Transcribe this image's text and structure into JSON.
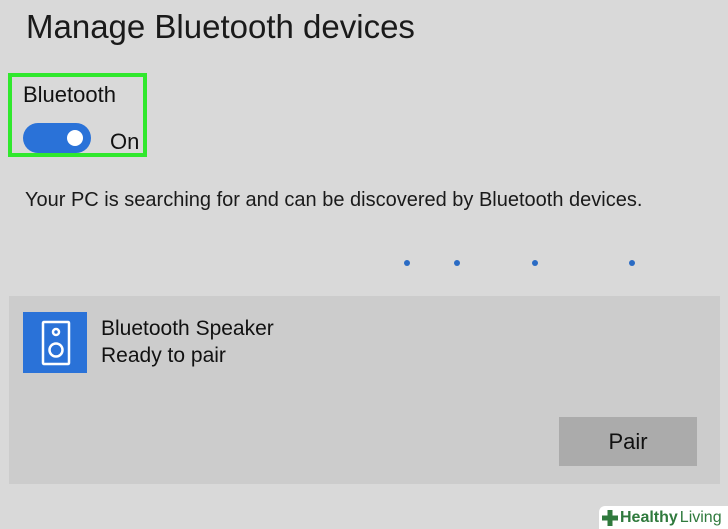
{
  "header": {
    "title": "Manage Bluetooth devices"
  },
  "bluetooth_toggle": {
    "label": "Bluetooth",
    "state_label": "On",
    "is_on": true,
    "highlight_color": "#30e82d",
    "accent_color": "#2a72d8"
  },
  "discovery": {
    "status_text": "Your PC is searching for and can be discovered by Bluetooth devices."
  },
  "devices": [
    {
      "name": "Bluetooth Speaker",
      "status": "Ready to pair",
      "icon": "speaker-icon",
      "action_label": "Pair"
    }
  ],
  "watermark": {
    "word1": "Healthy",
    "word2": "Living",
    "icon": "plus-icon"
  }
}
